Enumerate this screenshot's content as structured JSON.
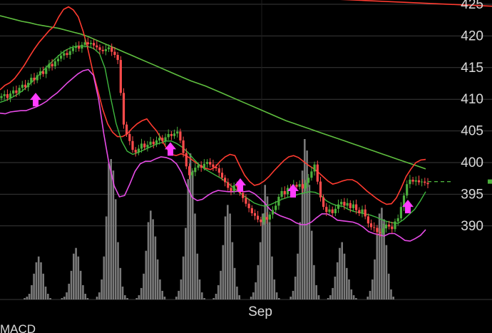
{
  "chart_data": {
    "type": "candlestick",
    "x_labels": [
      "Sep"
    ],
    "y_ticks": [
      425,
      420,
      415,
      410,
      405,
      400,
      395,
      390
    ],
    "y_range": [
      387.5,
      425
    ],
    "last_price": 397,
    "next_panel_label": "MACD",
    "colors": {
      "background": "#000000",
      "up": "#4caf3c",
      "down": "#ff4b4b",
      "upper_band": "#ff3b30",
      "lower_band": "#e64be6",
      "middle_band": "#3fb83f",
      "long_ma": "#5fbf3f",
      "volume": "#7a7a7a",
      "signal_arrow": "#ff3cff",
      "grid": "#3a3a3a"
    },
    "prices": [
      410.5,
      410.8,
      410.2,
      410.9,
      411.4,
      411.0,
      411.8,
      412.3,
      411.9,
      412.6,
      413.4,
      413.0,
      413.8,
      414.4,
      414.0,
      414.9,
      415.6,
      415.2,
      416.0,
      416.4,
      416.9,
      417.3,
      417.0,
      417.6,
      418.1,
      418.4,
      418.0,
      418.6,
      419.0,
      418.7,
      418.9,
      418.5,
      418.2,
      417.8,
      417.6,
      417.9,
      418.2,
      417.5,
      417.0,
      416.2,
      411.0,
      406.0,
      404.5,
      403.4,
      402.0,
      401.6,
      402.2,
      403.0,
      402.4,
      402.8,
      403.3,
      402.9,
      403.5,
      403.9,
      403.4,
      404.0,
      404.5,
      404.2,
      404.6,
      404.9,
      403.5,
      401.5,
      399.4,
      398.0,
      398.5,
      399.2,
      399.6,
      399.2,
      399.8,
      400.1,
      399.7,
      399.3,
      399.1,
      398.4,
      397.6,
      396.9,
      396.0,
      395.5,
      396.4,
      396.2,
      395.2,
      394.4,
      393.5,
      392.8,
      392.0,
      391.6,
      391.0,
      390.6,
      391.4,
      391.0,
      391.8,
      392.5,
      393.2,
      394.6,
      395.5,
      395.0,
      396.0,
      395.8,
      396.5,
      396.2,
      396.6,
      395.9,
      396.8,
      397.6,
      398.6,
      399.7,
      397.0,
      394.5,
      393.0,
      392.2,
      392.6,
      392.0,
      392.7,
      393.4,
      393.8,
      393.2,
      393.6,
      392.8,
      393.4,
      392.5,
      392.0,
      392.6,
      391.5,
      390.4,
      389.8,
      389.7,
      389.0,
      388.9,
      389.6,
      390.2,
      389.9,
      389.5,
      390.7,
      391.2,
      393.0,
      394.8,
      396.6,
      397.3,
      397.0,
      397.2,
      396.9,
      397.0,
      396.8,
      396.6
    ],
    "upper_band": [
      411.5,
      412.2,
      412.6,
      413.3,
      414.3,
      415.4,
      416.7,
      417.9,
      419.0,
      419.9,
      420.8,
      421.5,
      423.0,
      424.2,
      424.6,
      424.1,
      423.0,
      420.7,
      417.8,
      414.3,
      411.4,
      408.4,
      406.1,
      404.8,
      404.1,
      404.1,
      404.5,
      405.4,
      406.1,
      406.6,
      406.9,
      405.9,
      405.0,
      403.7,
      402.3,
      401.3,
      401.1,
      401.4,
      401.1,
      400.6,
      400.0,
      399.5,
      399.1,
      398.9,
      399.3,
      400.2,
      400.9,
      401.3,
      401.1,
      399.5,
      398.0,
      397.0,
      396.4,
      396.6,
      397.1,
      397.8,
      398.7,
      399.5,
      400.3,
      400.9,
      401.1,
      400.8,
      400.2,
      399.6,
      399.1,
      398.5,
      397.8,
      397.1,
      396.6,
      396.8,
      397.1,
      397.3,
      397.3,
      396.9,
      396.2,
      395.5,
      394.9,
      394.3,
      393.8,
      393.4,
      393.5,
      394.4,
      396.0,
      397.8,
      399.0,
      400.0,
      400.4,
      400.5
    ],
    "lower_band": [
      407.8,
      407.7,
      408.0,
      408.1,
      408.2,
      408.2,
      408.5,
      408.8,
      409.2,
      409.7,
      410.4,
      411.0,
      411.8,
      412.6,
      413.3,
      414.0,
      414.5,
      414.7,
      413.8,
      410.0,
      404.5,
      399.8,
      396.3,
      394.6,
      394.8,
      396.6,
      398.6,
      399.8,
      400.2,
      400.2,
      400.6,
      400.9,
      400.8,
      400.5,
      399.8,
      398.4,
      396.3,
      394.5,
      394.0,
      394.2,
      394.8,
      395.3,
      395.6,
      395.5,
      395.4,
      395.4,
      395.5,
      395.4,
      395.5,
      395.1,
      394.4,
      393.6,
      392.6,
      392.0,
      391.6,
      391.3,
      391.0,
      390.5,
      390.2,
      390.2,
      390.6,
      391.3,
      391.9,
      391.9,
      391.5,
      390.9,
      390.8,
      390.7,
      390.6,
      390.3,
      389.8,
      389.1,
      388.8,
      388.6,
      388.4,
      388.8,
      388.8,
      388.3,
      387.7,
      387.6,
      388.0,
      388.5,
      389.4
    ],
    "middle_band": [
      409.5,
      409.8,
      410.2,
      410.7,
      411.3,
      412.1,
      412.9,
      413.8,
      414.7,
      415.6,
      416.4,
      417.2,
      417.8,
      418.2,
      418.4,
      418.4,
      418.3,
      418.0,
      417.2,
      414.9,
      410.3,
      406.2,
      403.4,
      401.8,
      401.3,
      401.6,
      402.0,
      402.4,
      402.8,
      403.1,
      403.4,
      403.4,
      403.0,
      402.4,
      401.6,
      400.6,
      399.7,
      399.0,
      398.5,
      398.0,
      397.5,
      396.9,
      396.2,
      395.5,
      394.8,
      394.2,
      393.6,
      393.3,
      393.1,
      393.4,
      393.8,
      394.2,
      394.5,
      394.7,
      395.0,
      395.2,
      395.4,
      395.3,
      394.9,
      394.0,
      393.5,
      393.2,
      393.1,
      392.6,
      392.3,
      392.1,
      391.9,
      391.7,
      391.4,
      391.0,
      390.7,
      390.5,
      390.4,
      391.0,
      391.8,
      392.6,
      393.9,
      395.4
    ],
    "long_ma": [
      423.2,
      422.9,
      422.6,
      422.3,
      422.1,
      421.8,
      421.6,
      421.4,
      421.2,
      420.9,
      420.6,
      420.3,
      419.9,
      419.4,
      418.9,
      418.4,
      417.9,
      417.4,
      416.9,
      416.4,
      415.9,
      415.4,
      414.9,
      414.4,
      413.9,
      413.4,
      412.9,
      412.5,
      412.1,
      411.6,
      411.1,
      410.6,
      410.1,
      409.6,
      409.1,
      408.6,
      408.1,
      407.6,
      407.1,
      406.6,
      406.2,
      405.8,
      405.4,
      405.0,
      404.6,
      404.2,
      403.8,
      403.4,
      403.0,
      402.6,
      402.2,
      401.8,
      401.4,
      401.0,
      400.6,
      400.2,
      399.8,
      399.4,
      399.0
    ],
    "volume": [
      0,
      0,
      1,
      2,
      4,
      10,
      18,
      26,
      30,
      26,
      18,
      9,
      4,
      1,
      0,
      0,
      0,
      0,
      1,
      2,
      5,
      11,
      20,
      32,
      36,
      30,
      20,
      10,
      4,
      1,
      0,
      0,
      0,
      2,
      5,
      14,
      30,
      58,
      95,
      98,
      90,
      70,
      40,
      22,
      9,
      3,
      1,
      0,
      0,
      0,
      1,
      3,
      8,
      18,
      34,
      54,
      62,
      56,
      44,
      28,
      14,
      6,
      2,
      0,
      0,
      0,
      0,
      2,
      6,
      14,
      30,
      50,
      84,
      102,
      90,
      60,
      32,
      14,
      5,
      1,
      0,
      0,
      0,
      1,
      4,
      10,
      20,
      38,
      58,
      66,
      60,
      40,
      22,
      9,
      3,
      0,
      0,
      0,
      0,
      2,
      5,
      12,
      24,
      40,
      60,
      80,
      72,
      54,
      30,
      14,
      5,
      1,
      0,
      0,
      0,
      0,
      2,
      6,
      16,
      32,
      54,
      90,
      112,
      104,
      80,
      48,
      24,
      10,
      3,
      0,
      0,
      0,
      1,
      3,
      8,
      16,
      26,
      36,
      40,
      32,
      22,
      14,
      7,
      3,
      1,
      0,
      0,
      0,
      0,
      2,
      6,
      14,
      28,
      46,
      60,
      64,
      56,
      38,
      18,
      7,
      2,
      0
    ],
    "arrows": [
      {
        "price": 409.9
      },
      {
        "price": 402.1
      },
      {
        "price": 396.4
      },
      {
        "price": 395.5
      },
      {
        "price": 393.0
      }
    ],
    "trendline": [
      426.2,
      424.7
    ]
  }
}
